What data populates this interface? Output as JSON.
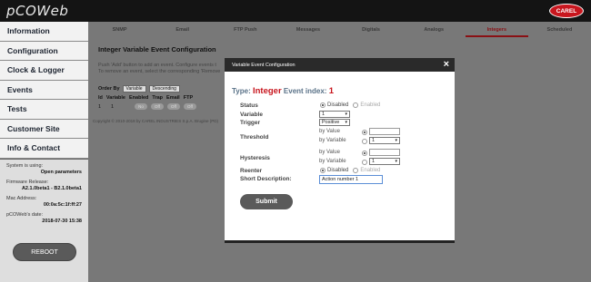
{
  "header": {
    "logo": "pCOWeb",
    "brand": "CAREL"
  },
  "sidebar": {
    "items": [
      {
        "label": "Information"
      },
      {
        "label": "Configuration"
      },
      {
        "label": "Clock & Logger"
      },
      {
        "label": "Events"
      },
      {
        "label": "Tests"
      },
      {
        "label": "Customer Site"
      },
      {
        "label": "Info & Contact"
      }
    ],
    "system_label": "System is using:",
    "system_value": "Open parameters",
    "firmware_label": "Firmware Release:",
    "firmware_value": "A2.1.0beta1  -  B2.1.0beta1",
    "mac_label": "Mac Address:",
    "mac_value": "00:0a:5c:1f:ff:27",
    "date_label": "pCOWeb's date:",
    "date_value": "2018-07-30 15:38",
    "reboot_label": "REBOOT"
  },
  "tabs": [
    {
      "label": "SNMP"
    },
    {
      "label": "Email"
    },
    {
      "label": "FTP Push"
    },
    {
      "label": "Messages"
    },
    {
      "label": "Digitals"
    },
    {
      "label": "Analogs"
    },
    {
      "label": "Integers"
    },
    {
      "label": "Scheduled"
    }
  ],
  "page": {
    "title": "Integer Variable Event Configuration",
    "help_line1": "Push 'Add' button to add an event. Configure events t",
    "help_line2": "To remove an event, select the corresponding 'Remove",
    "orderby_label": "Order By",
    "orderby_field": "Variable",
    "orderby_direction": "Descending",
    "table_headers": [
      "Id",
      "Variable",
      "Enabled",
      "Trap",
      "Email",
      "FTP"
    ],
    "table_row": {
      "id": "1",
      "variable": "1",
      "enabled": "No",
      "trap": "Off",
      "email": "Off",
      "ftp": "Off"
    },
    "copyright": "Copyright © 2010-2018 by CAREL INDUSTRIES S.p.A. Brugine (PD)"
  },
  "modal": {
    "title": "Variable Event Configuration",
    "close": "×",
    "type_label": "Type:",
    "type_value": "Integer",
    "event_index_label": "Event index:",
    "event_index_value": "1",
    "status_label": "Status",
    "status_disabled": "Disabled",
    "status_enabled": "Enabled",
    "variable_label": "Variable",
    "variable_value": "1",
    "trigger_label": "Trigger",
    "trigger_value": "Positive",
    "threshold_label": "Threshold",
    "by_value": "by Value",
    "by_variable": "by Variable",
    "threshold_var_value": "1",
    "hysteresis_label": "Hysteresis",
    "hysteresis_var_value": "1",
    "reenter_label": "Reenter",
    "reenter_disabled": "Disabled",
    "reenter_enabled": "Enabled",
    "desc_label": "Short Description:",
    "desc_value": "Action number 1",
    "submit_label": "Submit"
  }
}
